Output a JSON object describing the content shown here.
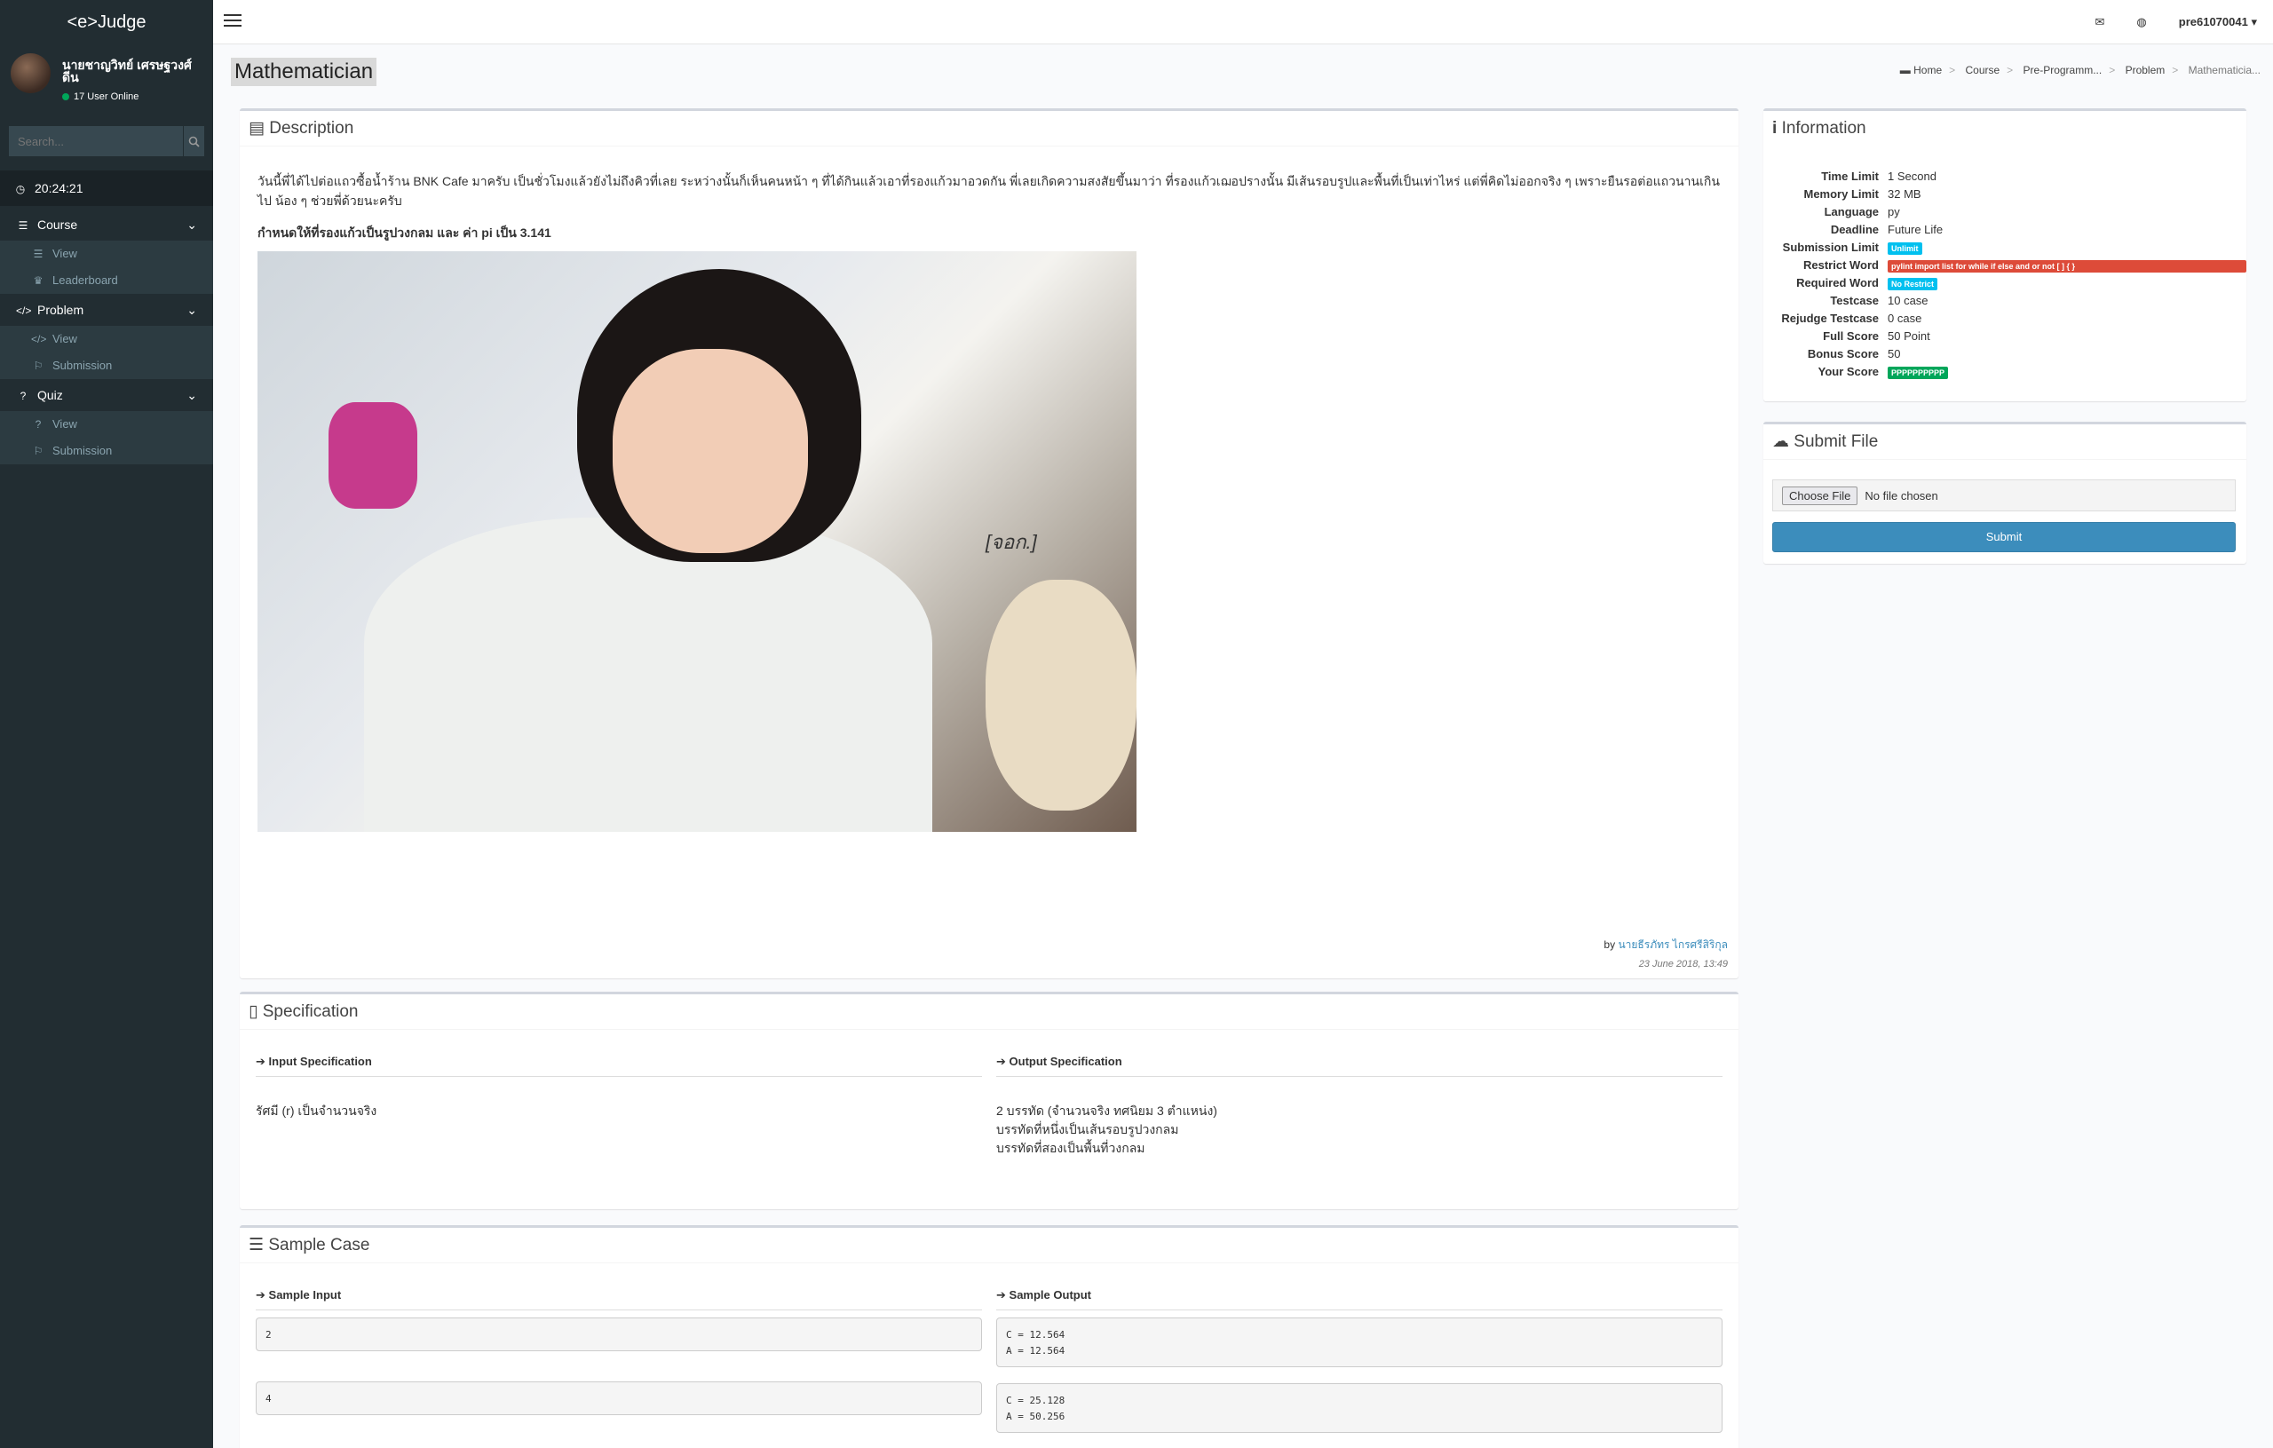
{
  "app": {
    "logo": "<e>Judge"
  },
  "user": {
    "name": "นายชาญวิทย์ เศรษฐวงศ์ดีน",
    "online": "17 User Online"
  },
  "search": {
    "placeholder": "Search..."
  },
  "clock": "20:24:21",
  "menu": {
    "course": {
      "label": "Course",
      "items": [
        "View",
        "Leaderboard"
      ]
    },
    "problem": {
      "label": "Problem",
      "items": [
        "View",
        "Submission"
      ]
    },
    "quiz": {
      "label": "Quiz",
      "items": [
        "View",
        "Submission"
      ]
    }
  },
  "topbar": {
    "username": "pre61070041"
  },
  "page": {
    "title": "Mathematician",
    "breadcrumb": [
      "Home",
      "Course",
      "Pre-Programm...",
      "Problem",
      "Mathematicia..."
    ]
  },
  "description": {
    "header": "Description",
    "para1": "วันนี้พี่ได้ไปต่อแถวซื้อน้ำร้าน BNK Cafe มาครับ เป็นชั่วโมงแล้วยังไม่ถึงคิวที่เลย ระหว่างนั้นก็เห็นคนหน้า ๆ ที่ได้กินแล้วเอาที่รองแก้วมาอวดกัน พี่เลยเกิดความสงสัยขึ้นมาว่า ที่รองแก้วเฌอปรางนั้น มีเส้นรอบรูปและพื้นที่เป็นเท่าไหร่ แต่พี่คิดไม่ออกจริง ๆ เพราะยืนรอต่อแถวนานเกินไป น้อง ๆ ช่วยพี่ด้วยนะครับ",
    "para2": "กำหนดให้ที่รองแก้วเป็นรูปวงกลม และ ค่า pi เป็น 3.141",
    "image_watermark": "[จอก.]",
    "author_prefix": "by",
    "author": "นายธีรภัทร ไกรศรีสิริกุล",
    "date": "23 June 2018, 13:49"
  },
  "specification": {
    "header": "Specification",
    "input_header": "Input Specification",
    "output_header": "Output Specification",
    "input": "รัศมี (r) เป็นจำนวนจริง",
    "output_lines": [
      "2 บรรทัด (จำนวนจริง ทศนิยม 3 ตำแหน่ง)",
      "บรรทัดที่หนึ่งเป็นเส้นรอบรูปวงกลม",
      "บรรทัดที่สองเป็นพื้นที่วงกลม"
    ]
  },
  "sample": {
    "header": "Sample Case",
    "input_header": "Sample Input",
    "output_header": "Sample Output",
    "cases": [
      {
        "input": "2",
        "output": "C = 12.564\nA = 12.564"
      },
      {
        "input": "4",
        "output": "C = 25.128\nA = 50.256"
      }
    ]
  },
  "information": {
    "header": "Information",
    "rows": [
      {
        "k": "Time Limit",
        "v": "1 Second"
      },
      {
        "k": "Memory Limit",
        "v": "32 MB"
      },
      {
        "k": "Language",
        "v": "py"
      },
      {
        "k": "Deadline",
        "v": "Future Life"
      },
      {
        "k": "Submission Limit",
        "v": "Unlimit"
      },
      {
        "k": "Restrict Word",
        "v": "pylint import list for while if else and or not [ ] { }"
      },
      {
        "k": "Required Word",
        "v": "No Restrict"
      },
      {
        "k": "Testcase",
        "v": "10 case"
      },
      {
        "k": "Rejudge Testcase",
        "v": "0 case"
      },
      {
        "k": "Full Score",
        "v": "50 Point"
      },
      {
        "k": "Bonus Score",
        "v": "50"
      },
      {
        "k": "Your Score",
        "v": "PPPPPPPPPP"
      }
    ],
    "colors": {
      "info": "#00c0ef",
      "danger": "#dd4b39",
      "success": "#00a65a"
    }
  },
  "submit": {
    "header": "Submit File",
    "choose": "Choose File",
    "nofile": "No file chosen",
    "button": "Submit"
  }
}
